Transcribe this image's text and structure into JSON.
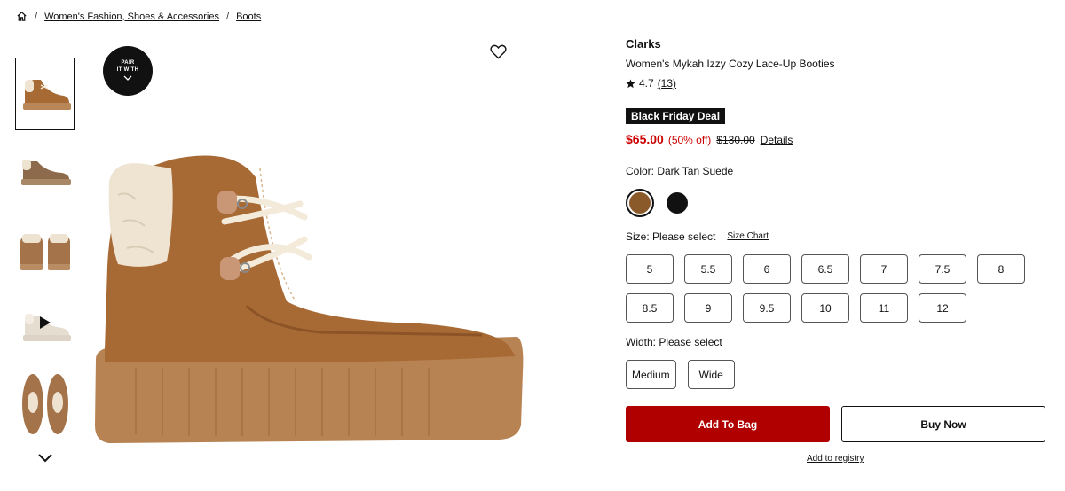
{
  "breadcrumb": {
    "home_icon": "home-icon",
    "items": [
      "Women's Fashion, Shoes & Accessories",
      "Boots"
    ],
    "separator": "/"
  },
  "gallery": {
    "thumbnails": [
      "boot-side-view",
      "boot-side-view-2",
      "boot-pair-front",
      "boot-video",
      "boot-pair-top"
    ],
    "selected_index": 0,
    "pair_badge": {
      "line1": "PAIR",
      "line2": "IT WITH"
    },
    "icons": {
      "wishlist": "heart-icon",
      "scroll_down": "chevron-down-icon",
      "video": "play-icon"
    }
  },
  "product": {
    "brand": "Clarks",
    "title": "Women's Mykah Izzy Cozy Lace-Up Booties",
    "rating": "4.7",
    "review_count": "(13)",
    "deal_badge": "Black Friday Deal",
    "price": "$65.00",
    "discount": "(50% off)",
    "original_price": "$130.00",
    "details_link": "Details",
    "color_label": "Color: Dark Tan Suede",
    "colors": [
      {
        "name": "Dark Tan Suede",
        "hex": "#8a5a2b",
        "selected": true
      },
      {
        "name": "Black",
        "hex": "#111111",
        "selected": false
      }
    ],
    "size_label": "Size: Please select",
    "size_chart_link": "Size Chart",
    "sizes": [
      "5",
      "5.5",
      "6",
      "6.5",
      "7",
      "7.5",
      "8",
      "8.5",
      "9",
      "9.5",
      "10",
      "11",
      "12"
    ],
    "width_label": "Width: Please select",
    "widths": [
      "Medium",
      "Wide"
    ]
  },
  "actions": {
    "add_to_bag": "Add To Bag",
    "buy_now": "Buy Now",
    "add_to_registry": "Add to registry"
  },
  "colors": {
    "sale_red": "#c00000",
    "button_red": "#b00000",
    "suede": "#a86a35",
    "sole": "#b98657",
    "shearling": "#efe4d2"
  }
}
